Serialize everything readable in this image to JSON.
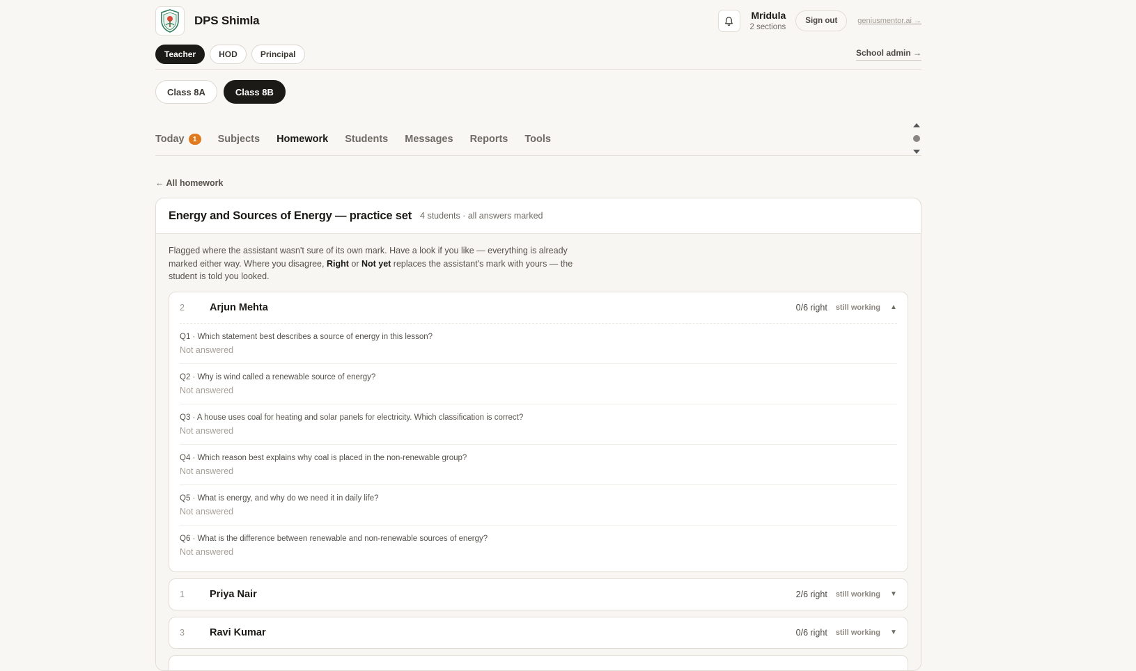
{
  "header": {
    "school_name": "DPS Shimla",
    "user_name": "Mridula",
    "user_sub": "2 sections",
    "sign_out": "Sign out",
    "ext_link": "geniusmentor.ai →"
  },
  "roles": {
    "items": [
      "Teacher",
      "HOD",
      "Principal"
    ],
    "active": "Teacher",
    "school_admin": "School admin →"
  },
  "classes": {
    "items": [
      "Class 8A",
      "Class 8B"
    ],
    "active": "Class 8B"
  },
  "tabs": {
    "items": [
      {
        "label": "Today",
        "badge": "1"
      },
      {
        "label": "Subjects"
      },
      {
        "label": "Homework"
      },
      {
        "label": "Students"
      },
      {
        "label": "Messages"
      },
      {
        "label": "Reports"
      },
      {
        "label": "Tools"
      }
    ],
    "active": "Homework"
  },
  "back_link": "← All homework",
  "homework": {
    "title": "Energy and Sources of Energy — practice set",
    "meta": "4 students · all answers marked",
    "note_part1": "Flagged where the assistant wasn't sure of its own mark. Have a look if you like — everything is already marked either way. Where you disagree, ",
    "note_right": "Right",
    "note_or": " or ",
    "note_notyet": "Not yet",
    "note_part2": " replaces the assistant's mark with yours — the student is told you looked."
  },
  "students": [
    {
      "rank": "2",
      "name": "Arjun Mehta",
      "score": "0/6 right",
      "status": "still working",
      "chevron": "▲",
      "questions": [
        {
          "text": "Q1 · Which statement best describes a source of energy in this lesson?",
          "answer": "Not answered"
        },
        {
          "text": "Q2 · Why is wind called a renewable source of energy?",
          "answer": "Not answered"
        },
        {
          "text": "Q3 · A house uses coal for heating and solar panels for electricity. Which classification is correct?",
          "answer": "Not answered"
        },
        {
          "text": "Q4 · Which reason best explains why coal is placed in the non-renewable group?",
          "answer": "Not answered"
        },
        {
          "text": "Q5 · What is energy, and why do we need it in daily life?",
          "answer": "Not answered"
        },
        {
          "text": "Q6 · What is the difference between renewable and non-renewable sources of energy?",
          "answer": "Not answered"
        }
      ]
    },
    {
      "rank": "1",
      "name": "Priya Nair",
      "score": "2/6 right",
      "status": "still working",
      "chevron": "▼"
    },
    {
      "rank": "3",
      "name": "Ravi Kumar",
      "score": "0/6 right",
      "status": "still working",
      "chevron": "▼"
    }
  ],
  "colors": {
    "accent_dark": "#1c1a17",
    "badge_orange": "#e07a1f",
    "background": "#f9f7f4"
  },
  "icons": [
    "school-crest-logo",
    "bell-icon",
    "chevron-up-icon",
    "chevron-down-icon"
  ]
}
